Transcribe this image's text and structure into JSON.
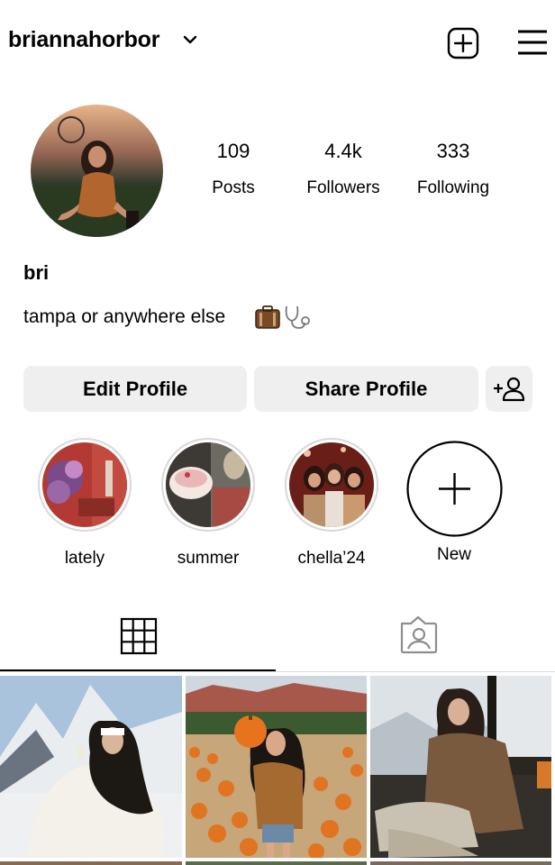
{
  "header": {
    "username": "briannahorbor",
    "icons": {
      "chevron": "chevron-down-icon",
      "new_post": "plus-square-icon",
      "menu": "hamburger-menu-icon"
    }
  },
  "profile": {
    "stats": [
      {
        "value": "109",
        "label": "Posts"
      },
      {
        "value": "4.4k",
        "label": "Followers"
      },
      {
        "value": "333",
        "label": "Following"
      }
    ],
    "display_name": "bri",
    "bio": "tampa or anywhere else"
  },
  "buttons": {
    "edit_profile": "Edit Profile",
    "share_profile": "Share Profile",
    "add_person_icon": "add-person-icon"
  },
  "highlights": [
    {
      "label": "lately"
    },
    {
      "label": "summer"
    },
    {
      "label": "chella’24"
    },
    {
      "label": "New"
    }
  ],
  "tabs": [
    {
      "name": "grid",
      "icon": "grid-icon",
      "active": true
    },
    {
      "name": "tagged",
      "icon": "tagged-person-icon",
      "active": false
    }
  ],
  "colors": {
    "button_bg": "#efefef",
    "ring": "#d8d8d8",
    "text": "#000000"
  }
}
